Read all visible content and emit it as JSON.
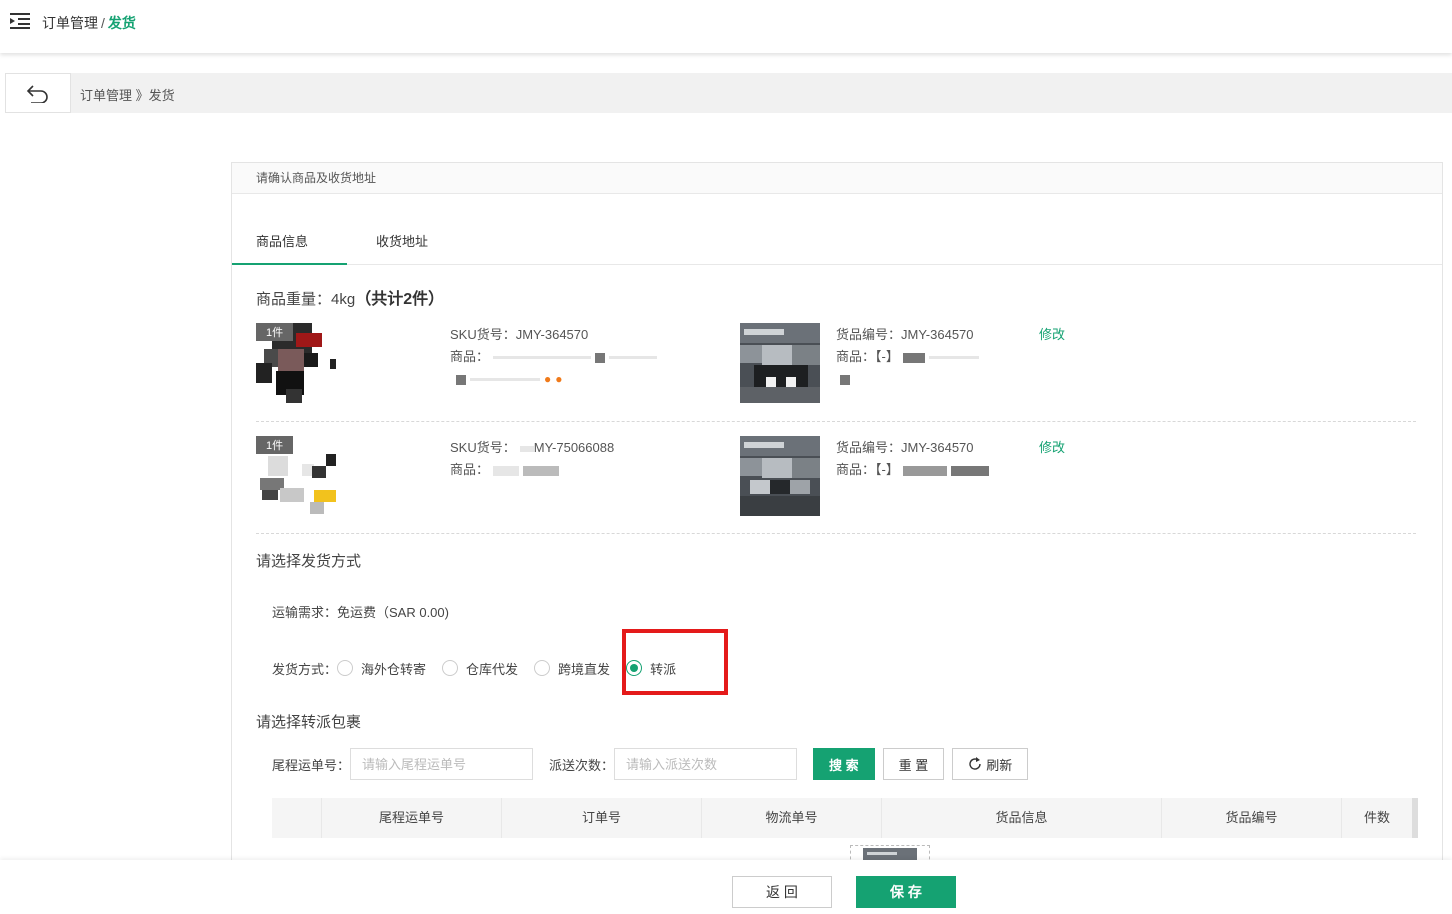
{
  "topbar": {
    "menu_icon": "menu-fold-icon",
    "breadcrumb_parent": "订单管理",
    "breadcrumb_sep": "/",
    "breadcrumb_current": "发货"
  },
  "subbar": {
    "back_icon": "undo-arrow-icon",
    "breadcrumb": "订单管理 》发货"
  },
  "panel": {
    "header": "请确认商品及收货地址",
    "tabs": [
      {
        "label": "商品信息",
        "active": true
      },
      {
        "label": "收货地址",
        "active": false
      }
    ],
    "weight_label": "商品重量：4kg",
    "weight_total": "（共计2件）",
    "items": [
      {
        "qty": "1件",
        "sku_label": "SKU货号：JMY-364570",
        "product_label": "商品：",
        "goods_no_label": "货品编号：JMY-364570",
        "goods_product_label": "商品：【-】",
        "edit_label": "修改"
      },
      {
        "qty": "1件",
        "sku_label": "SKU货号：",
        "sku_value": "MY-75066088",
        "product_label": "商品：",
        "goods_no_label": "货品编号：JMY-364570",
        "goods_product_label": "商品：【-】",
        "edit_label": "修改"
      }
    ],
    "shipping_title": "请选择发货方式",
    "transport": "运输需求：免运费（SAR 0.00)",
    "ship_method_label": "发货方式：",
    "ship_options": [
      {
        "label": "海外仓转寄",
        "selected": false
      },
      {
        "label": "仓库代发",
        "selected": false
      },
      {
        "label": "跨境直发",
        "selected": false
      },
      {
        "label": "转派",
        "selected": true
      }
    ],
    "transfer_title": "请选择转派包裹",
    "filters": {
      "tracking_label": "尾程运单号：",
      "tracking_placeholder": "请输入尾程运单号",
      "times_label": "派送次数：",
      "times_placeholder": "请输入派送次数",
      "search_label": "搜 索",
      "reset_label": "重 置",
      "refresh_label": "刷新",
      "refresh_icon": "refresh-icon"
    },
    "table_headers": [
      "尾程运单号",
      "订单号",
      "物流单号",
      "货品信息",
      "货品编号",
      "件数"
    ]
  },
  "footer": {
    "back_label": "返 回",
    "save_label": "保 存"
  },
  "colors": {
    "accent": "#15a272",
    "highlight": "#e41a1a"
  }
}
